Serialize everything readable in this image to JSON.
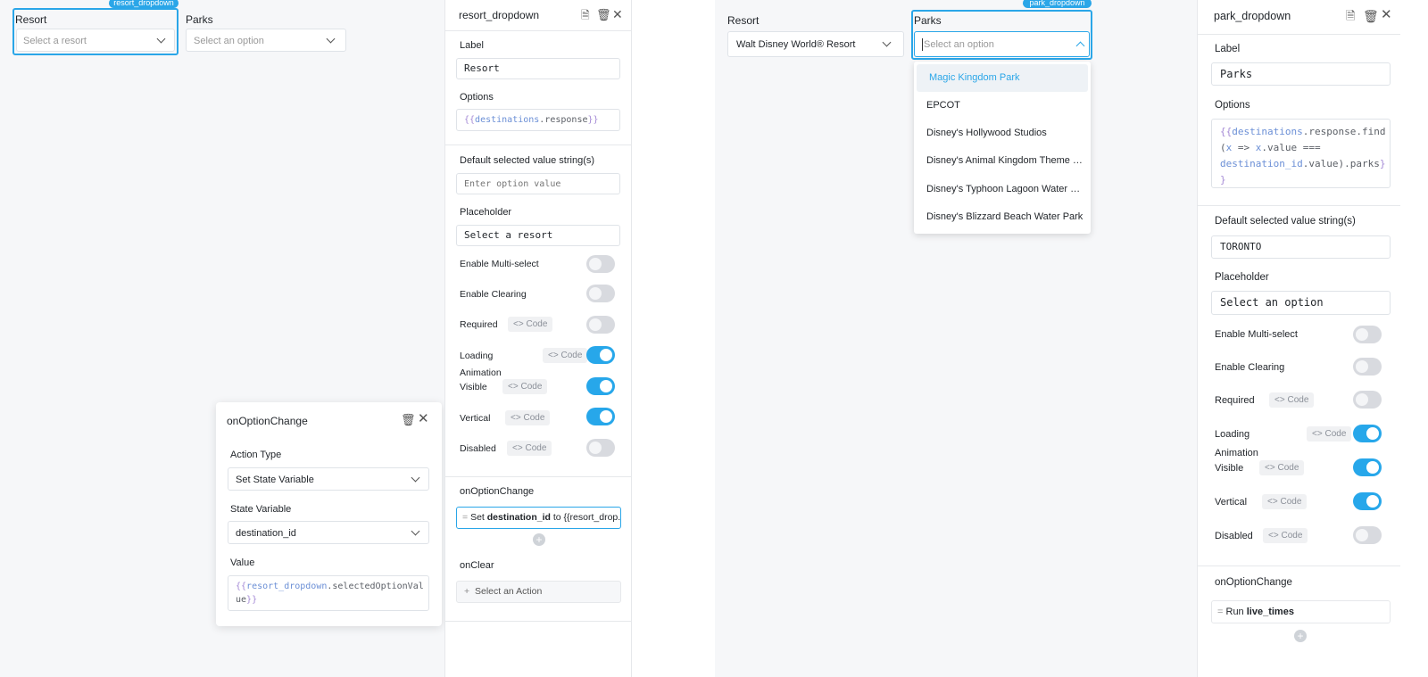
{
  "left": {
    "resort": {
      "label": "Resort",
      "placeholder": "Select a resort",
      "tag": "resort_dropdown"
    },
    "parks": {
      "label": "Parks",
      "placeholder": "Select an option"
    },
    "event_panel": {
      "title": "onOptionChange",
      "action_type_label": "Action Type",
      "action_type_value": "Set State Variable",
      "state_variable_label": "State Variable",
      "state_variable_value": "destination_id",
      "value_label": "Value",
      "value_line1_var": "resort_dropdown",
      "value_line1_prop": ".selectedOptionVal",
      "value_line2": "ue"
    }
  },
  "inspector1": {
    "title": "resort_dropdown",
    "label_label": "Label",
    "label_value": "Resort",
    "options_label": "Options",
    "options_var": "destinations",
    "options_prop": ".response",
    "default_label": "Default selected value string(s)",
    "default_placeholder": "Enter option value",
    "placeholder_label": "Placeholder",
    "placeholder_value": "Select a resort",
    "toggles": [
      {
        "label": "Enable Multi-select",
        "code": "",
        "on": false
      },
      {
        "label": "Enable Clearing",
        "code": "",
        "on": false
      },
      {
        "label": "Required",
        "code": "Code",
        "on": false
      },
      {
        "label": "Loading Animation",
        "code": "Code",
        "on": true
      },
      {
        "label": "Visible",
        "code": "Code",
        "on": true
      },
      {
        "label": "Vertical",
        "code": "Code",
        "on": true
      },
      {
        "label": "Disabled",
        "code": "Code",
        "on": false
      }
    ],
    "loading_line1": "Loading",
    "loading_line2": "Animation",
    "event_label": "onOptionChange",
    "event_prefix": "Set",
    "event_var": "destination_id",
    "event_suffix": "to {{resort_drop...",
    "onclear_label": "onClear",
    "onclear_action": "Select an Action"
  },
  "right": {
    "resort": {
      "label": "Resort",
      "value": "Walt Disney World® Resort"
    },
    "parks": {
      "label": "Parks",
      "placeholder": "Select an option",
      "tag": "park_dropdown"
    },
    "options": [
      "Magic Kingdom Park",
      "EPCOT",
      "Disney's Hollywood Studios",
      "Disney's Animal Kingdom Theme Park",
      "Disney's Typhoon Lagoon Water Park",
      "Disney's Blizzard Beach Water Park"
    ]
  },
  "inspector2": {
    "title": "park_dropdown",
    "label_label": "Label",
    "label_value": "Parks",
    "options_label": "Options",
    "options_l1_var": "destinations",
    "options_l1_prop": ".response.find",
    "options_l2_a": "(",
    "options_l2_x": "x",
    "options_l2_b": " => ",
    "options_l2_x2": "x",
    "options_l2_c": ".value ===",
    "options_l3_var": "destination_id",
    "options_l3_prop": ".value).parks",
    "default_label": "Default selected value string(s)",
    "default_value": "TORONTO",
    "placeholder_label": "Placeholder",
    "placeholder_value": "Select an option",
    "toggles": [
      {
        "label": "Enable Multi-select",
        "code": "",
        "on": false
      },
      {
        "label": "Enable Clearing",
        "code": "",
        "on": false
      },
      {
        "label": "Required",
        "code": "Code",
        "on": false
      },
      {
        "label": "Loading Animation",
        "code": "Code",
        "on": true
      },
      {
        "label": "Visible",
        "code": "Code",
        "on": true
      },
      {
        "label": "Vertical",
        "code": "Code",
        "on": true
      },
      {
        "label": "Disabled",
        "code": "Code",
        "on": false
      }
    ],
    "loading_line1": "Loading",
    "loading_line2": "Animation",
    "event_label": "onOptionChange",
    "event_prefix": "Run",
    "event_query": "live_times"
  },
  "colors": {
    "accent": "#27a7ea",
    "canvas": "#f6f7f9",
    "var": "#a58bd6"
  }
}
